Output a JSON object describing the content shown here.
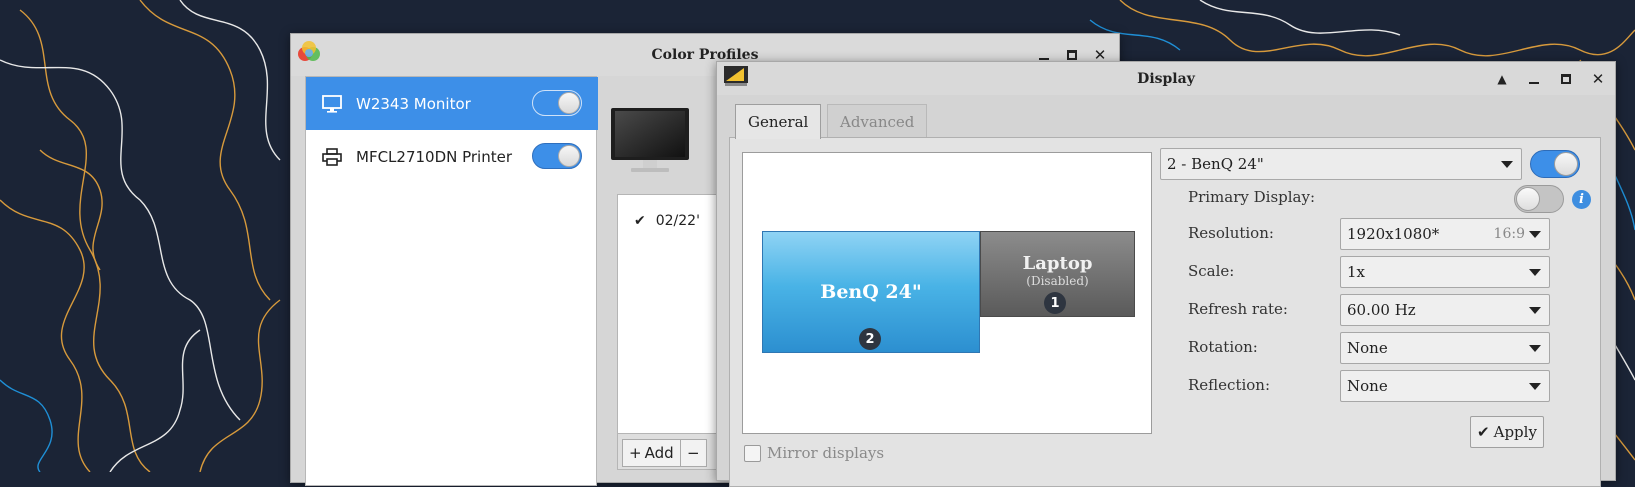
{
  "colors": {
    "accent": "#3d8fe8",
    "wallpaper": "#1b2436",
    "line_orange": "#d79a3c",
    "line_white": "#e8e8e8",
    "line_blue": "#1f8fd6"
  },
  "color_profiles": {
    "title": "Color Profiles",
    "devices": [
      {
        "label": "W2343 Monitor",
        "icon": "monitor-icon",
        "enabled": true,
        "selected": true
      },
      {
        "label": "MFCL2710DN Printer",
        "icon": "printer-icon",
        "enabled": true,
        "selected": false
      }
    ],
    "profile_entry": "02/22'",
    "add_label": "Add",
    "remove_label": "−"
  },
  "display": {
    "title": "Display",
    "tabs": [
      {
        "label": "General",
        "active": true
      },
      {
        "label": "Advanced",
        "active": false
      }
    ],
    "screens": {
      "benq": {
        "name": "BenQ 24\"",
        "number": "2"
      },
      "laptop": {
        "name": "Laptop",
        "status": "(Disabled)",
        "number": "1"
      }
    },
    "mirror_label": "Mirror displays",
    "selected_display": "2 - BenQ 24\"",
    "properties": {
      "primary_label": "Primary Display:",
      "resolution_label": "Resolution:",
      "resolution_value": "1920x1080*",
      "resolution_aspect": "16:9",
      "scale_label": "Scale:",
      "scale_value": "1x",
      "refresh_label": "Refresh rate:",
      "refresh_value": "60.00 Hz",
      "rotation_label": "Rotation:",
      "rotation_value": "None",
      "reflection_label": "Reflection:",
      "reflection_value": "None"
    },
    "apply_label": "Apply",
    "info_glyph": "i"
  }
}
